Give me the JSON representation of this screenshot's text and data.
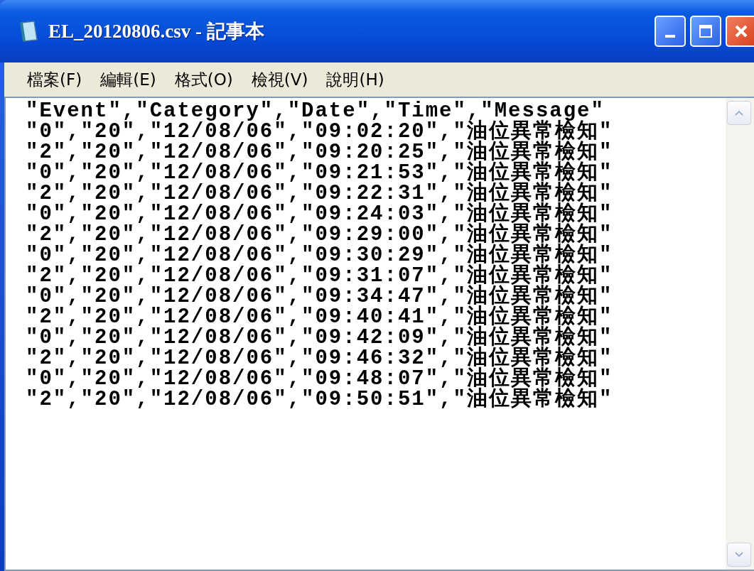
{
  "window": {
    "title": "EL_20120806.csv - 記事本"
  },
  "menu": [
    {
      "label": "檔案(F)"
    },
    {
      "label": "編輯(E)"
    },
    {
      "label": "格式(O)"
    },
    {
      "label": "檢視(V)"
    },
    {
      "label": "說明(H)"
    }
  ],
  "lines": [
    "\"Event\",\"Category\",\"Date\",\"Time\",\"Message\"",
    "\"0\",\"20\",\"12/08/06\",\"09:02:20\",\"油位異常檢知\"",
    "\"2\",\"20\",\"12/08/06\",\"09:20:25\",\"油位異常檢知\"",
    "\"0\",\"20\",\"12/08/06\",\"09:21:53\",\"油位異常檢知\"",
    "\"2\",\"20\",\"12/08/06\",\"09:22:31\",\"油位異常檢知\"",
    "\"0\",\"20\",\"12/08/06\",\"09:24:03\",\"油位異常檢知\"",
    "\"2\",\"20\",\"12/08/06\",\"09:29:00\",\"油位異常檢知\"",
    "\"0\",\"20\",\"12/08/06\",\"09:30:29\",\"油位異常檢知\"",
    "\"2\",\"20\",\"12/08/06\",\"09:31:07\",\"油位異常檢知\"",
    "\"0\",\"20\",\"12/08/06\",\"09:34:47\",\"油位異常檢知\"",
    "\"2\",\"20\",\"12/08/06\",\"09:40:41\",\"油位異常檢知\"",
    "\"0\",\"20\",\"12/08/06\",\"09:42:09\",\"油位異常檢知\"",
    "\"2\",\"20\",\"12/08/06\",\"09:46:32\",\"油位異常檢知\"",
    "\"0\",\"20\",\"12/08/06\",\"09:48:07\",\"油位異常檢知\"",
    "\"2\",\"20\",\"12/08/06\",\"09:50:51\",\"油位異常檢知\""
  ]
}
